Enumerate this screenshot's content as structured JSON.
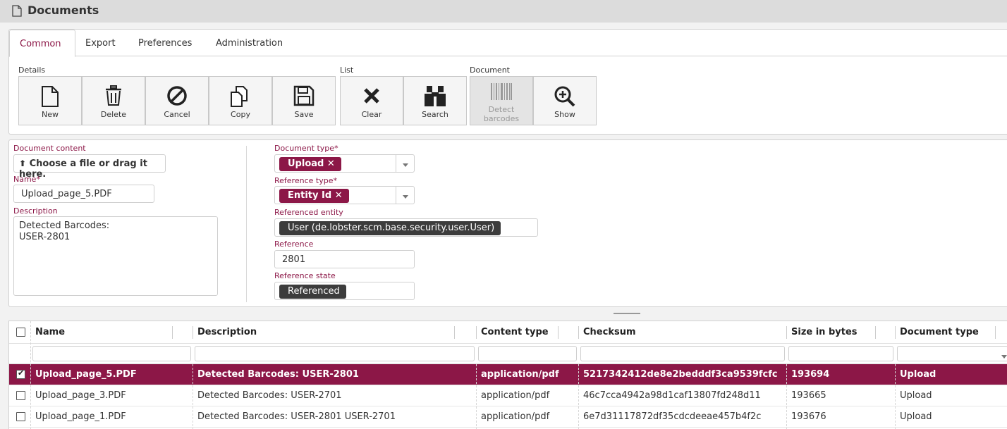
{
  "app": {
    "title": "Documents"
  },
  "tabs": [
    {
      "label": "Common",
      "active": true
    },
    {
      "label": "Export"
    },
    {
      "label": "Preferences"
    },
    {
      "label": "Administration"
    }
  ],
  "toolbar": {
    "groups": {
      "details": "Details",
      "list": "List",
      "document": "Document"
    },
    "buttons": {
      "new": "New",
      "delete": "Delete",
      "cancel": "Cancel",
      "copy": "Copy",
      "save": "Save",
      "clear": "Clear",
      "search": "Search",
      "detect_barcodes_1": "Detect",
      "detect_barcodes_2": "barcodes",
      "show": "Show"
    }
  },
  "form": {
    "document_content": {
      "label": "Document content",
      "button": "Choose a file or drag it here."
    },
    "name": {
      "label": "Name",
      "required": "*",
      "value": "Upload_page_5.PDF"
    },
    "description": {
      "label": "Description",
      "line1": "Detected Barcodes:",
      "line2": "USER-2801"
    },
    "document_type": {
      "label": "Document type",
      "required": "*",
      "value": "Upload",
      "remove": "✕"
    },
    "reference_type": {
      "label": "Reference type",
      "required": "*",
      "value": "Entity Id",
      "remove": "✕"
    },
    "referenced_entity": {
      "label": "Referenced entity",
      "value": "User (de.lobster.scm.base.security.user.User)"
    },
    "reference": {
      "label": "Reference",
      "value": "2801"
    },
    "reference_state": {
      "label": "Reference state",
      "value": "Referenced"
    }
  },
  "table": {
    "columns": {
      "name": "Name",
      "description": "Description",
      "content_type": "Content type",
      "checksum": "Checksum",
      "size": "Size in bytes",
      "document_type": "Document type"
    },
    "rows": [
      {
        "name": "Upload_page_5.PDF",
        "description": "Detected Barcodes: USER-2801",
        "content_type": "application/pdf",
        "checksum": "5217342412de8e2bedddf3ca9539fcfc",
        "size": "193694",
        "document_type": "Upload",
        "selected": true
      },
      {
        "name": "Upload_page_3.PDF",
        "description": "Detected Barcodes: USER-2701",
        "content_type": "application/pdf",
        "checksum": "46c7cca4942a98d1caf13807fd248d11",
        "size": "193665",
        "document_type": "Upload",
        "selected": false
      },
      {
        "name": "Upload_page_1.PDF",
        "description": "Detected Barcodes: USER-2801 USER-2701",
        "content_type": "application/pdf",
        "checksum": "6e7d31117872df35cdcdeeae457b4f2c",
        "size": "193676",
        "document_type": "Upload",
        "selected": false
      }
    ]
  },
  "colors": {
    "accent": "#8c1747",
    "chip_dark": "#3c3c3c"
  }
}
